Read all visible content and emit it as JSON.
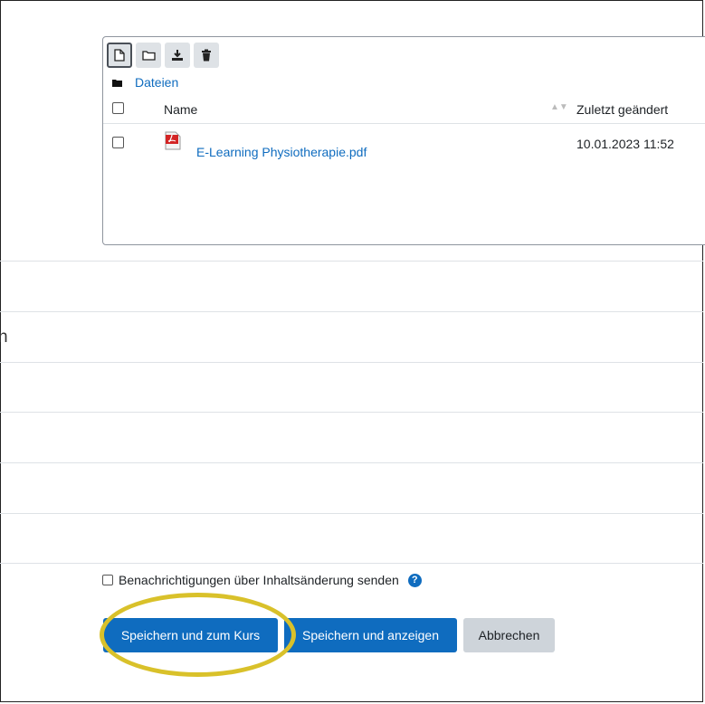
{
  "filemanager": {
    "toolbar": [
      "file-icon",
      "folder-icon",
      "download-icon",
      "trash-icon"
    ],
    "path_label": "Dateien",
    "header": {
      "name": "Name",
      "modified": "Zuletzt geändert"
    },
    "files": [
      {
        "name": "E-Learning Physiotherapie.pdf",
        "modified": "10.01.2023 11:52"
      }
    ]
  },
  "cut_label": "n",
  "notify_label": "Benachrichtigungen über Inhaltsänderung senden",
  "help_icon": "?",
  "buttons": {
    "save_course": "Speichern und zum Kurs",
    "save_show": "Speichern und anzeigen",
    "cancel": "Abbrechen"
  },
  "colors": {
    "accent": "#0f6cbf",
    "highlight": "#d9c12a"
  }
}
